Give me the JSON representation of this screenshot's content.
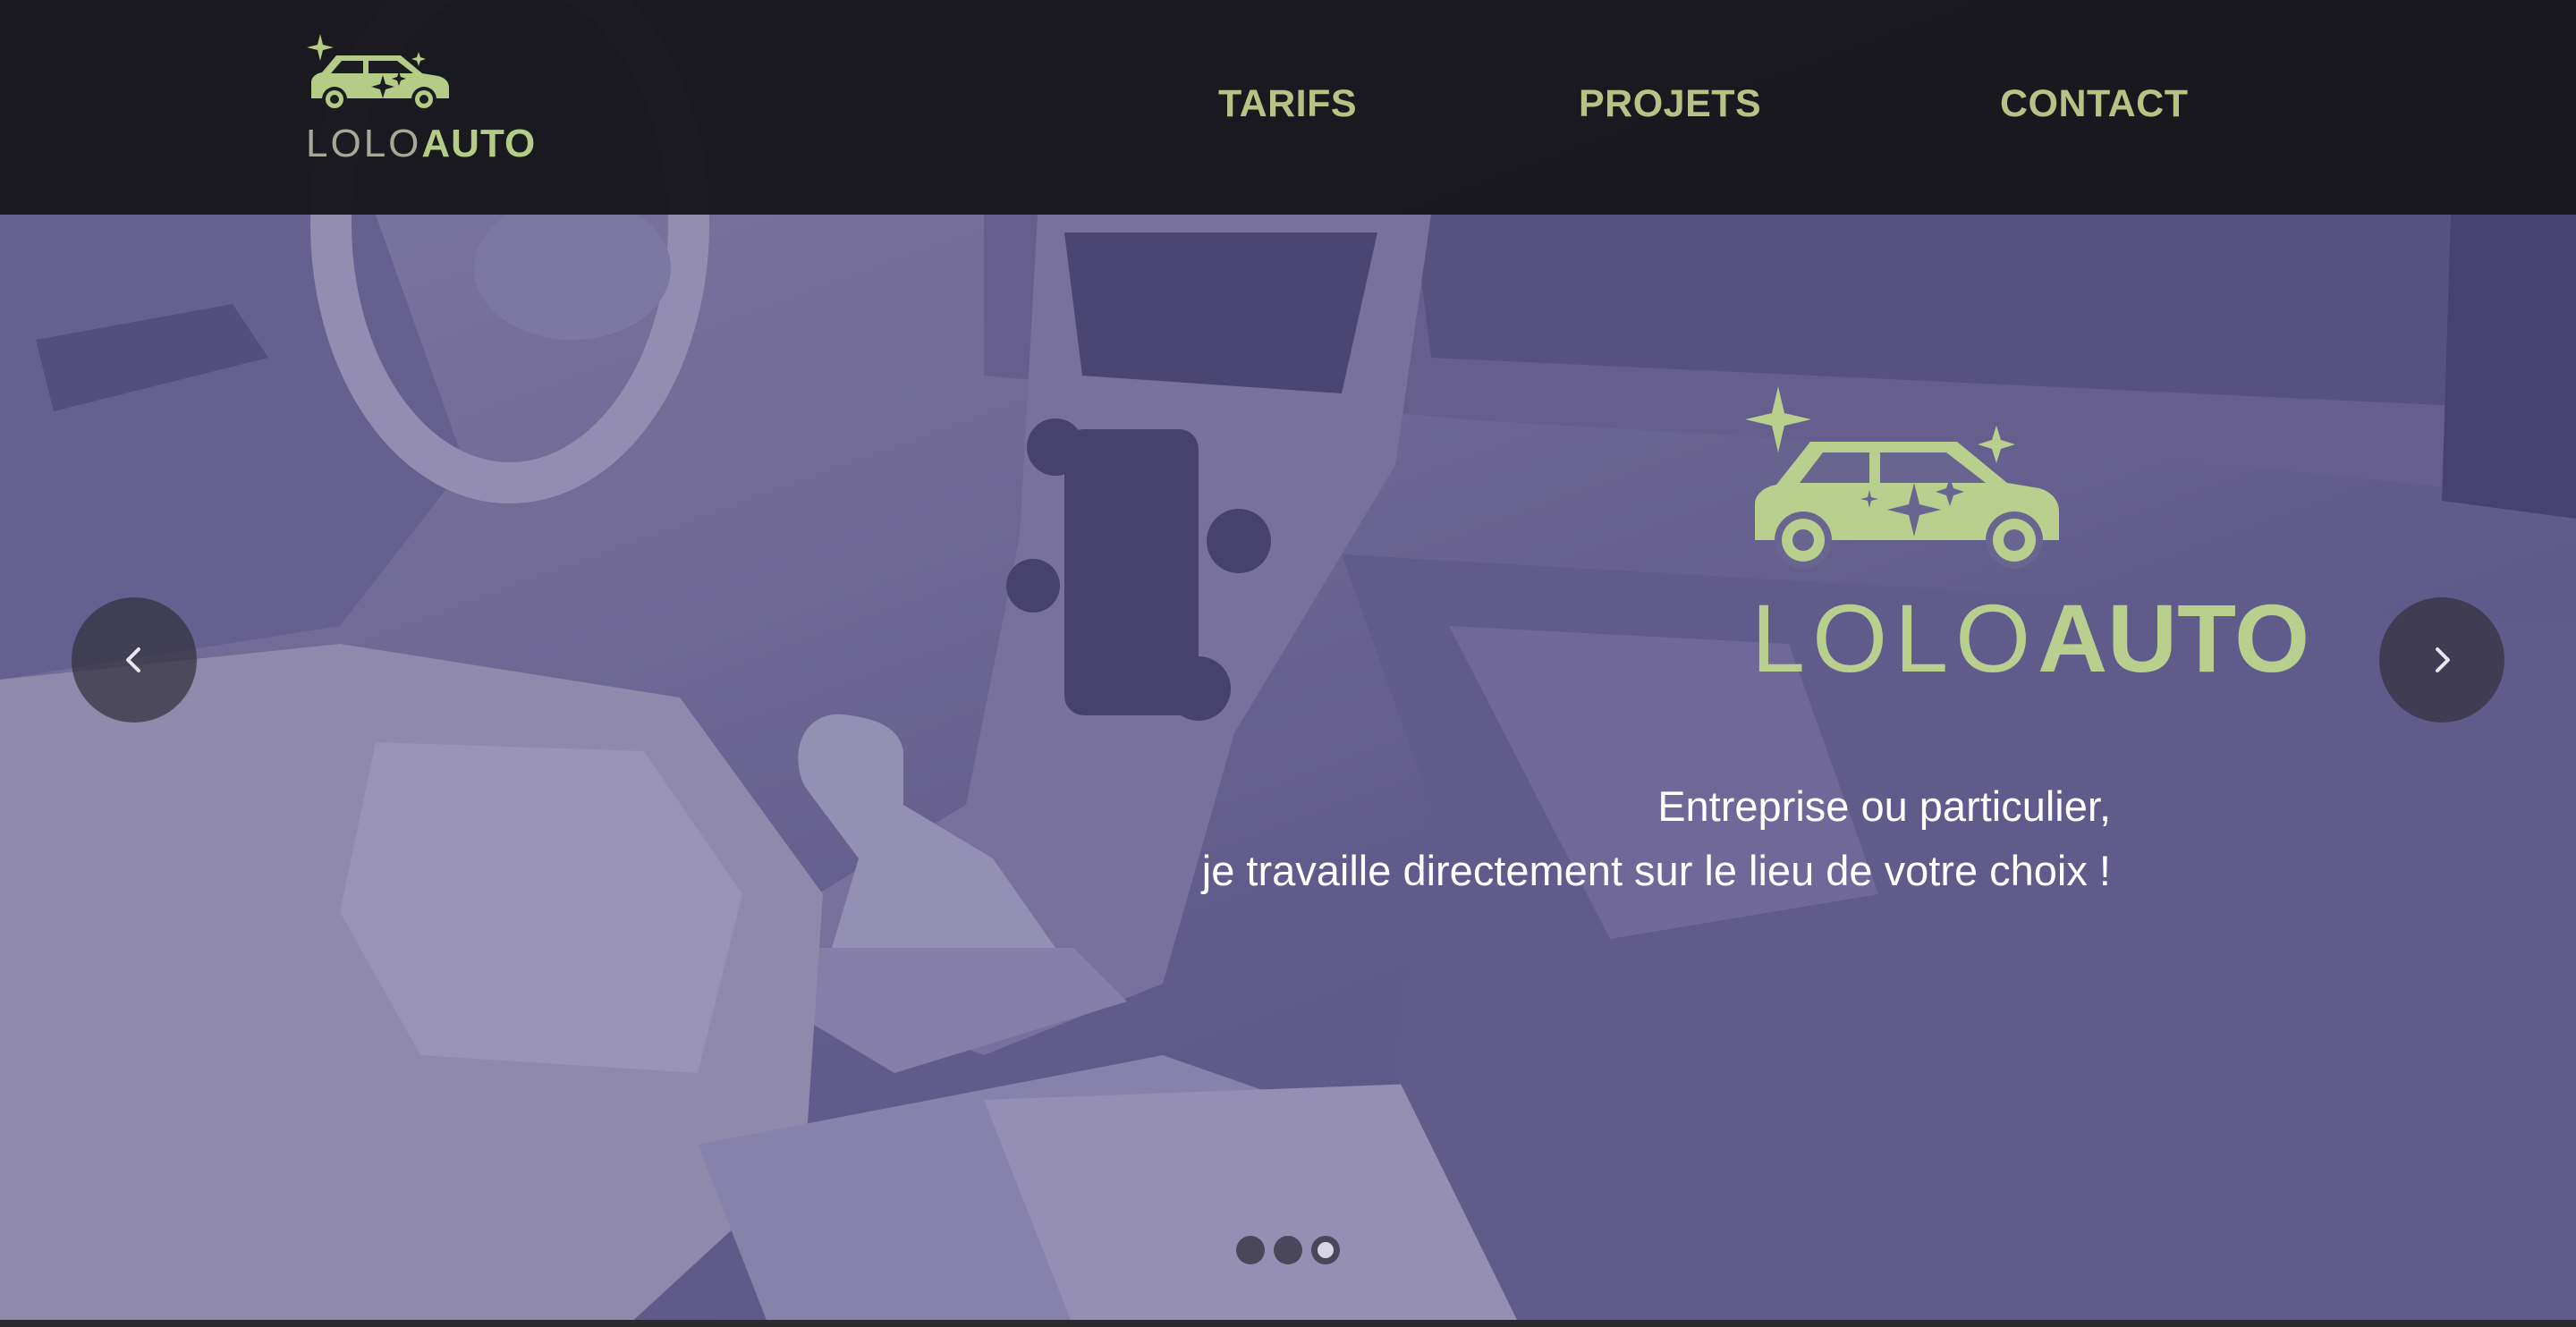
{
  "header": {
    "logo": {
      "word_light": "LOLO",
      "word_bold": "AUTO"
    },
    "nav": [
      {
        "label": "TARIFS"
      },
      {
        "label": "PROJETS"
      },
      {
        "label": "CONTACT"
      }
    ]
  },
  "hero": {
    "logo": {
      "word_light": "LOLO",
      "word_bold": "AUTO"
    },
    "tagline_line1": "Entreprise ou particulier,",
    "tagline_line2": "je travaille directement sur le lieu de votre choix !"
  },
  "carousel": {
    "prev_icon": "chevron-left-icon",
    "next_icon": "chevron-right-icon",
    "slide_count": 3,
    "active_slide": 3
  },
  "colors": {
    "brand_green": "#b4cc86",
    "nav_text": "#b9c184",
    "header_bg": "#121216",
    "hero_overlay": "#6a6590"
  }
}
